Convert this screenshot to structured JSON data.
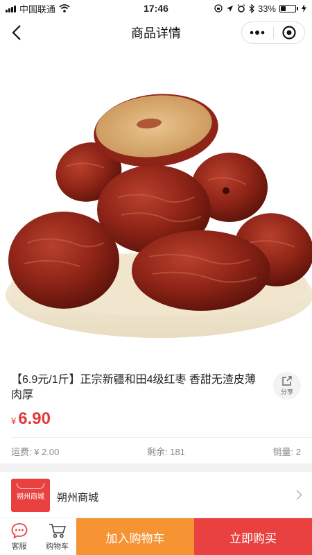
{
  "status_bar": {
    "carrier": "中国联通",
    "time": "17:46",
    "battery_percent": "33%",
    "battery_level": 0.33,
    "icons": [
      "signal-icon",
      "wifi-icon",
      "lock-rotation-icon",
      "location-icon",
      "alarm-icon",
      "bluetooth-icon",
      "battery-icon",
      "charging-icon"
    ]
  },
  "nav": {
    "title": "商品详情",
    "icons": [
      "back-arrow-icon",
      "more-dots-icon",
      "close-target-icon"
    ]
  },
  "product": {
    "image": "red-jujube-dates-on-plate",
    "title": "【6.9元/1斤】正宗新疆和田4级红枣 香甜无渣皮薄肉厚",
    "share_label": "分享",
    "price_symbol": "¥",
    "price": "6.90",
    "shipping": "运费: ¥ 2.00",
    "stock": "剩余: 181",
    "sales": "销量: 2"
  },
  "shop": {
    "logo_text": "朔州商城",
    "name": "朔州商城"
  },
  "bottom_bar": {
    "service_label": "客服",
    "cart_label": "购物车",
    "add_to_cart_label": "加入购物车",
    "buy_now_label": "立即购买"
  },
  "colors": {
    "price": "#e4393c",
    "add_to_cart": "#f69434",
    "buy_now": "#e8413f",
    "shop_logo": "#e8413f",
    "service_icon": "#e8413f"
  }
}
